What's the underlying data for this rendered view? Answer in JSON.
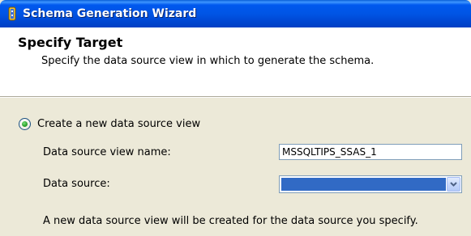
{
  "window": {
    "title": "Schema Generation Wizard",
    "icon": "wizard-app-icon"
  },
  "header": {
    "title": "Specify Target",
    "subtitle": "Specify the data source view in which to generate the schema."
  },
  "options": {
    "create_new_dsv": {
      "label": "Create a new data source view",
      "selected": true
    }
  },
  "fields": {
    "dsv_name": {
      "label": "Data source view name:",
      "value": "MSSQLTIPS_SSAS_1"
    },
    "data_source": {
      "label": "Data source:",
      "selected_value": ""
    }
  },
  "note": "A new data source view will be created for the data source you specify.",
  "colors": {
    "titlebar": "#0055E5",
    "selection": "#316AC5",
    "dialog_bg": "#ECE9D8"
  }
}
